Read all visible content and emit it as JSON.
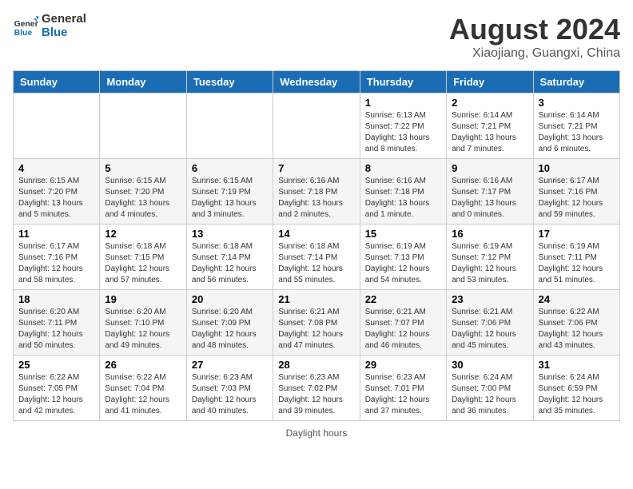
{
  "header": {
    "logo_general": "General",
    "logo_blue": "Blue",
    "month_title": "August 2024",
    "subtitle": "Xiaojiang, Guangxi, China"
  },
  "calendar": {
    "days_of_week": [
      "Sunday",
      "Monday",
      "Tuesday",
      "Wednesday",
      "Thursday",
      "Friday",
      "Saturday"
    ],
    "weeks": [
      [
        {
          "day": "",
          "info": ""
        },
        {
          "day": "",
          "info": ""
        },
        {
          "day": "",
          "info": ""
        },
        {
          "day": "",
          "info": ""
        },
        {
          "day": "1",
          "info": "Sunrise: 6:13 AM\nSunset: 7:22 PM\nDaylight: 13 hours\nand 8 minutes."
        },
        {
          "day": "2",
          "info": "Sunrise: 6:14 AM\nSunset: 7:21 PM\nDaylight: 13 hours\nand 7 minutes."
        },
        {
          "day": "3",
          "info": "Sunrise: 6:14 AM\nSunset: 7:21 PM\nDaylight: 13 hours\nand 6 minutes."
        }
      ],
      [
        {
          "day": "4",
          "info": "Sunrise: 6:15 AM\nSunset: 7:20 PM\nDaylight: 13 hours\nand 5 minutes."
        },
        {
          "day": "5",
          "info": "Sunrise: 6:15 AM\nSunset: 7:20 PM\nDaylight: 13 hours\nand 4 minutes."
        },
        {
          "day": "6",
          "info": "Sunrise: 6:15 AM\nSunset: 7:19 PM\nDaylight: 13 hours\nand 3 minutes."
        },
        {
          "day": "7",
          "info": "Sunrise: 6:16 AM\nSunset: 7:18 PM\nDaylight: 13 hours\nand 2 minutes."
        },
        {
          "day": "8",
          "info": "Sunrise: 6:16 AM\nSunset: 7:18 PM\nDaylight: 13 hours\nand 1 minute."
        },
        {
          "day": "9",
          "info": "Sunrise: 6:16 AM\nSunset: 7:17 PM\nDaylight: 13 hours\nand 0 minutes."
        },
        {
          "day": "10",
          "info": "Sunrise: 6:17 AM\nSunset: 7:16 PM\nDaylight: 12 hours\nand 59 minutes."
        }
      ],
      [
        {
          "day": "11",
          "info": "Sunrise: 6:17 AM\nSunset: 7:16 PM\nDaylight: 12 hours\nand 58 minutes."
        },
        {
          "day": "12",
          "info": "Sunrise: 6:18 AM\nSunset: 7:15 PM\nDaylight: 12 hours\nand 57 minutes."
        },
        {
          "day": "13",
          "info": "Sunrise: 6:18 AM\nSunset: 7:14 PM\nDaylight: 12 hours\nand 56 minutes."
        },
        {
          "day": "14",
          "info": "Sunrise: 6:18 AM\nSunset: 7:14 PM\nDaylight: 12 hours\nand 55 minutes."
        },
        {
          "day": "15",
          "info": "Sunrise: 6:19 AM\nSunset: 7:13 PM\nDaylight: 12 hours\nand 54 minutes."
        },
        {
          "day": "16",
          "info": "Sunrise: 6:19 AM\nSunset: 7:12 PM\nDaylight: 12 hours\nand 53 minutes."
        },
        {
          "day": "17",
          "info": "Sunrise: 6:19 AM\nSunset: 7:11 PM\nDaylight: 12 hours\nand 51 minutes."
        }
      ],
      [
        {
          "day": "18",
          "info": "Sunrise: 6:20 AM\nSunset: 7:11 PM\nDaylight: 12 hours\nand 50 minutes."
        },
        {
          "day": "19",
          "info": "Sunrise: 6:20 AM\nSunset: 7:10 PM\nDaylight: 12 hours\nand 49 minutes."
        },
        {
          "day": "20",
          "info": "Sunrise: 6:20 AM\nSunset: 7:09 PM\nDaylight: 12 hours\nand 48 minutes."
        },
        {
          "day": "21",
          "info": "Sunrise: 6:21 AM\nSunset: 7:08 PM\nDaylight: 12 hours\nand 47 minutes."
        },
        {
          "day": "22",
          "info": "Sunrise: 6:21 AM\nSunset: 7:07 PM\nDaylight: 12 hours\nand 46 minutes."
        },
        {
          "day": "23",
          "info": "Sunrise: 6:21 AM\nSunset: 7:06 PM\nDaylight: 12 hours\nand 45 minutes."
        },
        {
          "day": "24",
          "info": "Sunrise: 6:22 AM\nSunset: 7:06 PM\nDaylight: 12 hours\nand 43 minutes."
        }
      ],
      [
        {
          "day": "25",
          "info": "Sunrise: 6:22 AM\nSunset: 7:05 PM\nDaylight: 12 hours\nand 42 minutes."
        },
        {
          "day": "26",
          "info": "Sunrise: 6:22 AM\nSunset: 7:04 PM\nDaylight: 12 hours\nand 41 minutes."
        },
        {
          "day": "27",
          "info": "Sunrise: 6:23 AM\nSunset: 7:03 PM\nDaylight: 12 hours\nand 40 minutes."
        },
        {
          "day": "28",
          "info": "Sunrise: 6:23 AM\nSunset: 7:02 PM\nDaylight: 12 hours\nand 39 minutes."
        },
        {
          "day": "29",
          "info": "Sunrise: 6:23 AM\nSunset: 7:01 PM\nDaylight: 12 hours\nand 37 minutes."
        },
        {
          "day": "30",
          "info": "Sunrise: 6:24 AM\nSunset: 7:00 PM\nDaylight: 12 hours\nand 36 minutes."
        },
        {
          "day": "31",
          "info": "Sunrise: 6:24 AM\nSunset: 6:59 PM\nDaylight: 12 hours\nand 35 minutes."
        }
      ]
    ]
  },
  "footer": {
    "note": "Daylight hours"
  },
  "colors": {
    "header_bg": "#1a6db5",
    "accent": "#1a6db5"
  }
}
